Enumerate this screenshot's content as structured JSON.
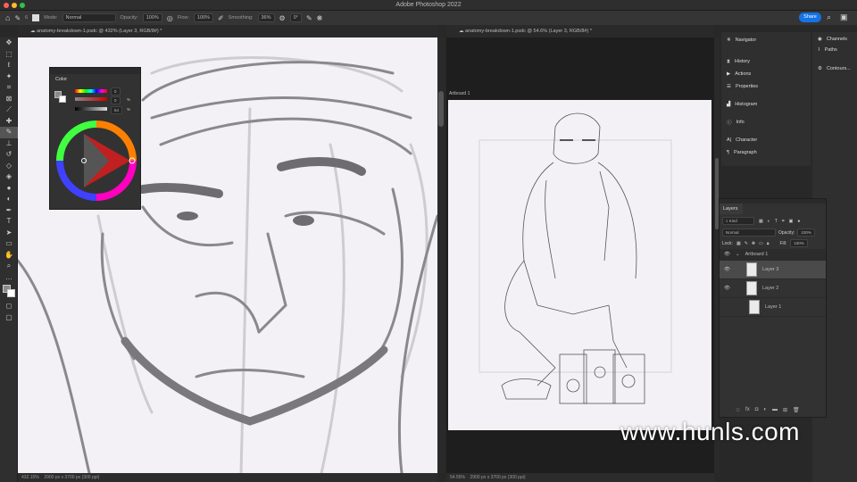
{
  "app": {
    "title": "Adobe Photoshop 2022"
  },
  "options": {
    "mode_label": "Mode:",
    "mode": "Normal",
    "opacity_label": "Opacity:",
    "opacity": "100%",
    "flow_label": "Flow:",
    "flow": "100%",
    "smoothing_label": "Smoothing:",
    "smoothing": "36%",
    "angle": "0°",
    "brush_size": "6",
    "share": "Share"
  },
  "docs": [
    {
      "tab": "anatomy-breakdown-1.psdc @ 432% (Layer 3, RGB/8#) *",
      "zoom": "432.15%",
      "size": "2900 px x 3700 px (300 ppi)"
    },
    {
      "tab": "anatomy-breakdown-1.psdc @ 54.6% (Layer 3, RGB/8#) *",
      "zoom": "54.55%",
      "size": "2900 px x 3700 px (300 ppi)",
      "artboard": "Artboard 1"
    }
  ],
  "color_panel": {
    "title": "Color",
    "h": "0",
    "s": "0",
    "b": "54",
    "s_unit": "%",
    "b_unit": "%"
  },
  "panels_left": [
    {
      "icon": "navigator-icon",
      "label": "Navigator"
    },
    {
      "icon": "history-icon",
      "label": "History"
    },
    {
      "icon": "actions-icon",
      "label": "Actions"
    },
    {
      "icon": "properties-icon",
      "label": "Properties"
    },
    {
      "icon": "histogram-icon",
      "label": "Histogram"
    },
    {
      "icon": "info-icon",
      "label": "Info"
    },
    {
      "icon": "character-icon",
      "label": "Character"
    },
    {
      "icon": "paragraph-icon",
      "label": "Paragraph"
    }
  ],
  "panels_right": [
    {
      "icon": "channels-icon",
      "label": "Channels"
    },
    {
      "icon": "paths-icon",
      "label": "Paths"
    },
    {
      "icon": "contours-icon",
      "label": "Contours..."
    }
  ],
  "layers": {
    "title": "Layers",
    "filter": "Kind",
    "blend": "Normal",
    "opacity_label": "Opacity:",
    "opacity": "100%",
    "lock_label": "Lock:",
    "fill_label": "Fill:",
    "fill": "100%",
    "group": "Artboard 1",
    "items": [
      {
        "name": "Layer 3",
        "selected": true,
        "visible": true
      },
      {
        "name": "Layer 2",
        "selected": false,
        "visible": true
      },
      {
        "name": "Layer 1",
        "selected": false,
        "visible": false
      }
    ]
  },
  "watermark": "www.hunls.com",
  "colors": {
    "accent": "#1473e6",
    "canvas": "#f4f1f6"
  }
}
